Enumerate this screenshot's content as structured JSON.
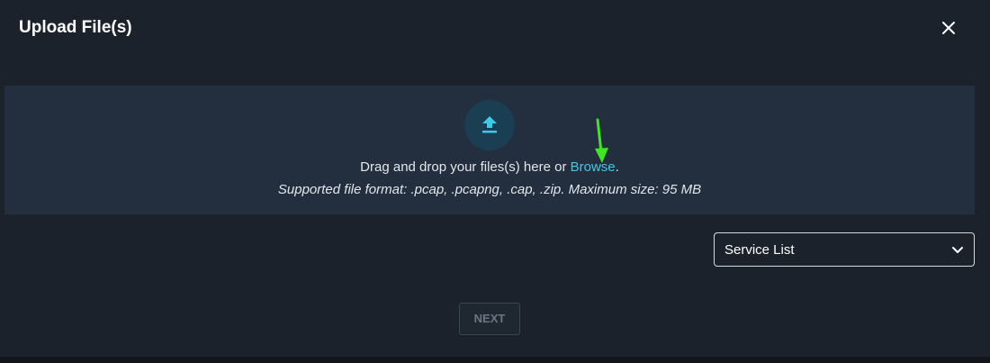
{
  "dialog": {
    "title": "Upload File(s)",
    "close_icon": "close-icon"
  },
  "dropzone": {
    "icon": "upload-icon",
    "text_prefix": "Drag and drop your files(s) here or ",
    "browse_label": "Browse",
    "text_suffix": ".",
    "formats_text": "Supported file format: .pcap, .pcapng, .cap, .zip. Maximum size: 95 MB",
    "annotation_color": "#3ee81c"
  },
  "service_select": {
    "selected": "Service List",
    "icon": "chevron-down-icon"
  },
  "footer": {
    "next_label": "NEXT"
  },
  "colors": {
    "background": "#1b222c",
    "dropzone": "#232f3e",
    "accent": "#3dc9ea"
  }
}
